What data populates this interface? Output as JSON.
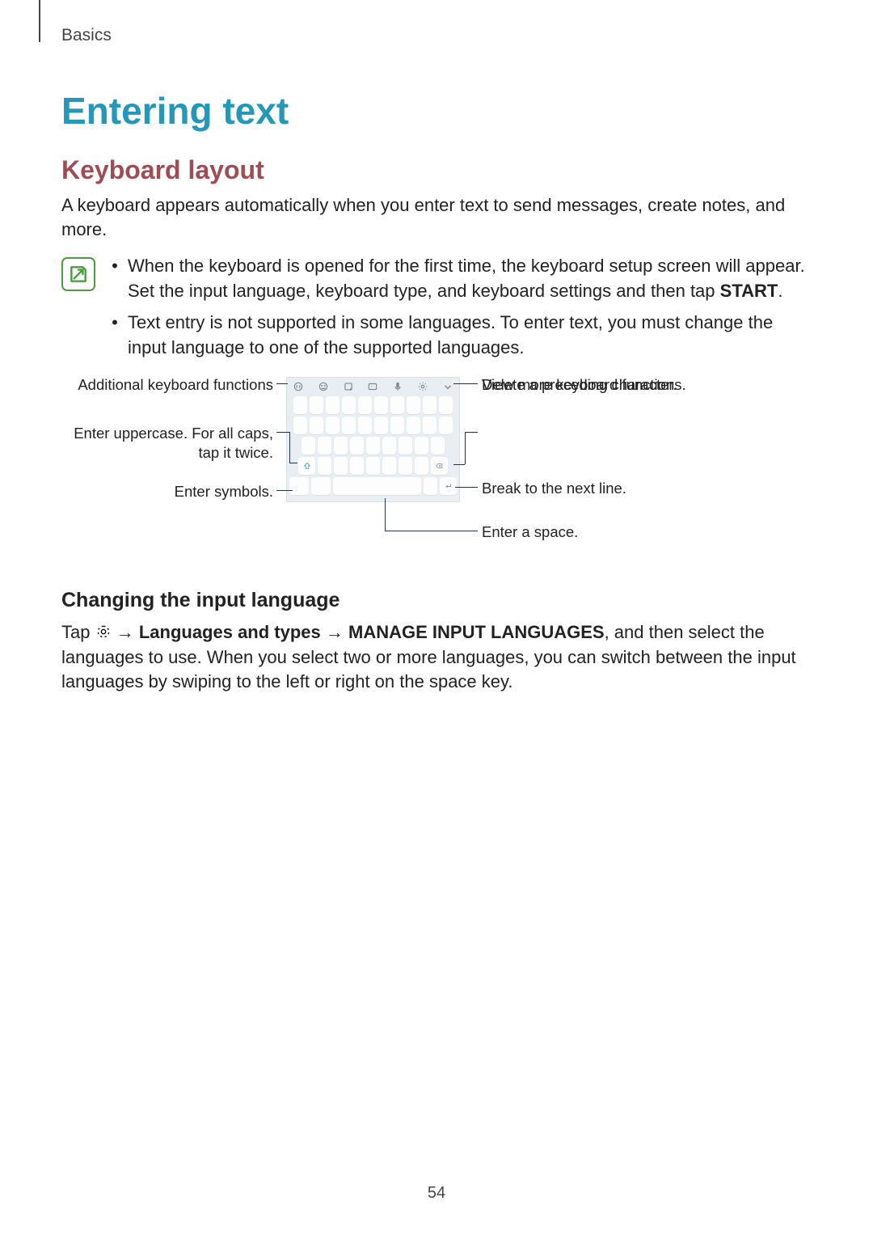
{
  "running_head": "Basics",
  "title": "Entering text",
  "h2": "Keyboard layout",
  "intro": "A keyboard appears automatically when you enter text to send messages, create notes, and more.",
  "notice": {
    "item1_a": "When the keyboard is opened for the first time, the keyboard setup screen will appear. Set the input language, keyboard type, and keyboard settings and then tap ",
    "item1_b": "START",
    "item1_c": ".",
    "item2": "Text entry is not supported in some languages. To enter text, you must change the input language to one of the supported languages."
  },
  "callouts": {
    "left1": "Additional keyboard functions",
    "left2": "Enter uppercase. For all caps, tap it twice.",
    "left3": "Enter symbols.",
    "right1": "View more keyboard functions.",
    "right2": "Delete a preceding character.",
    "right3": "Break to the next line.",
    "right4": "Enter a space."
  },
  "h3": "Changing the input language",
  "lang_para": {
    "a": "Tap ",
    "b": " → ",
    "c": "Languages and types",
    "d": " → ",
    "e": "MANAGE INPUT LANGUAGES",
    "f": ", and then select the languages to use. When you select two or more languages, you can switch between the input languages by swiping to the left or right on the space key."
  },
  "page_number": "54"
}
